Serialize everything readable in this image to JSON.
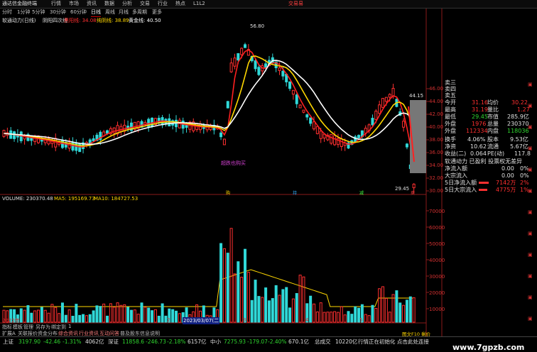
{
  "topbar": {
    "app_title": "通达信金融终端",
    "menus": [
      "行情",
      "市场",
      "资讯",
      "数据",
      "分析",
      "交易",
      "行业",
      "热点",
      "L1L2"
    ],
    "right_label": "交易易"
  },
  "periods": [
    "分时",
    "1分钟",
    "5分钟",
    "30分钟",
    "60分钟",
    "日线",
    "周线",
    "月线",
    "多周期",
    "更多"
  ],
  "active_period_index": 5,
  "indicator_title": {
    "name": "软通动力(日线)",
    "formula": "阴阳四次线",
    "ma1": "黑阳线: 34.08",
    "ma2": "纯阴线: 38.89",
    "ma3": "黄金线: 40.50"
  },
  "price_axis": [
    "46.00",
    "44.00",
    "42.00",
    "40.00",
    "38.00",
    "36.00",
    "34.00",
    "32.00",
    "30.00"
  ],
  "annotations": {
    "high": "56.80",
    "low": "29.45",
    "last_marker": "44.15",
    "signal_text": "超跌也购买",
    "marker_a": "购",
    "marker_b": "持",
    "marker_c": "减",
    "marker_d": "卖"
  },
  "volume_info": {
    "volume": "VOLUME: 230370.48",
    "ma5": "MA5: 195169.73",
    "ma10": "MA10: 184727.53"
  },
  "volume_axis": [
    "70000",
    "60000",
    "50000",
    "40000",
    "30000",
    "20000",
    "10000"
  ],
  "date_axis": {
    "left": "2022年",
    "highlight": "2023/03/07(二",
    "m2": "2",
    "m3": "3",
    "m4": "4",
    "m5": "5",
    "m6": "6"
  },
  "order_book": {
    "rows": [
      "卖三",
      "卖四",
      "卖五"
    ]
  },
  "quote": {
    "rows": [
      {
        "l1": "今开",
        "v1": "31.16",
        "l2": "均价",
        "v2": "30.22"
      },
      {
        "l1": "最高",
        "v1": "31.19",
        "l2": "量比",
        "v2": "1.27"
      },
      {
        "l1": "最低",
        "v1": "29.45",
        "l2": "市值",
        "v2": "285.9亿"
      },
      {
        "l1": "外盘",
        "v1": "1976",
        "l2": "总量",
        "v2": "230370"
      },
      {
        "l1": "外盘",
        "v1": "112334",
        "l2": "内盘",
        "v2": "118036"
      },
      {
        "l1": "换手",
        "v1": "4.06%",
        "l2": "股本",
        "v2": "9.53亿"
      },
      {
        "l1": "净资",
        "v1": "10.62",
        "l2": "流通",
        "v2": "5.67亿"
      },
      {
        "l1": "收益(二)",
        "v1": "0.064",
        "l2": "PE(动)",
        "v2": "117.8"
      }
    ],
    "status_line": "软通动力 已盈利 投票权无差异",
    "flow": [
      {
        "label": "净流入额",
        "v1": "0.00",
        "v2": "0%"
      },
      {
        "label": "大宗流入",
        "v1": "0.00",
        "v2": "0%"
      },
      {
        "label": "5日净流入额",
        "v1": "7142万",
        "v2": "2%"
      },
      {
        "label": "5日大宗流入",
        "v1": "4775万",
        "v2": "1%"
      }
    ]
  },
  "bottom_tabs": [
    "指标",
    "模板",
    "管理",
    "另存为",
    "绑定到",
    "1"
  ],
  "sub_tabs": [
    "扩展A",
    "关联报价",
    "资金分布",
    "综合资讯",
    "行业资讯",
    "互动问答",
    "普及股东信息说明"
  ],
  "statusbar": {
    "sh_label": "上证",
    "sh_value": "3197.90",
    "sh_change": "-42.46",
    "sh_pct": "-1.31%",
    "sh_amount": "4062亿",
    "sz_label": "深证",
    "sz_value": "11858.6",
    "sz_change": "-246.73",
    "sz_pct": "-2.18%",
    "sz_amount": "6157亿",
    "zx_label": "中小",
    "zx_value": "7275.93",
    "zx_change": "-179.07",
    "zx_pct": "-2.40%",
    "zx_amount": "670.1亿",
    "total_label": "总成交",
    "total_value": "10220亿",
    "notice": "行情正在初始化 点击此处连接"
  },
  "footer_tag": "图文F10 剩价",
  "watermark": "www.7gpzb.com",
  "colors": {
    "up": "#ff3030",
    "down": "#30d8d8",
    "white_line": "#ffffff",
    "yellow_line": "#ffd700",
    "bg": "#000000"
  }
}
